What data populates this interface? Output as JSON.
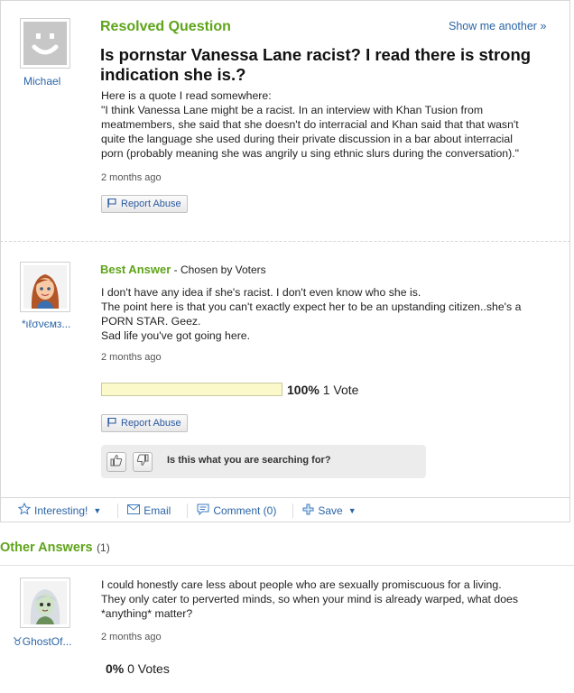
{
  "question": {
    "status_label": "Resolved Question",
    "show_another": "Show me another »",
    "asker": "Michael",
    "title_line1": "Is pornstar Vanessa Lane racist? I read there is strong",
    "title_line2": "indication she is.?",
    "body_lines": [
      "Here is a quote I read somewhere:",
      "\"I think Vanessa Lane might be a racist. In an interview with Khan Tusion from",
      "meatmembers, she said that she doesn't do interracial and Khan said that that wasn't",
      "quite the language she used during their private discussion in a bar about interracial",
      "porn (probably meaning she was angrily u sing ethnic slurs during the conversation).\""
    ],
    "time": "2 months ago",
    "report_label": "Report Abuse"
  },
  "best_answer": {
    "heading": "Best Answer",
    "chosen_by": " - Chosen by Voters",
    "user": "*ιℓσνємз...",
    "body_lines": [
      "I don't have any idea if she's racist. I don't even know who she is.",
      "The point here is that you can't exactly expect her to be an upstanding citizen..she's a",
      "PORN STAR. Geez.",
      "Sad life you've got going here."
    ],
    "time": "2 months ago",
    "vote_percent_label": "100%",
    "vote_percent": 100,
    "vote_count_label": "1 Vote",
    "report_label": "Report Abuse",
    "feedback_prompt": "Is this what you are searching for?"
  },
  "toolbar": {
    "interesting": "Interesting!",
    "email": "Email",
    "comment": "Comment (0)",
    "save": "Save"
  },
  "other_answers": {
    "heading": "Other Answers",
    "count": "(1)",
    "items": [
      {
        "user": "♉GhostOf...",
        "body_lines": [
          "I could honestly care less about people who are sexually promiscuous for a living.",
          "They only cater to perverted minds, so when your mind is already warped, what does",
          "*anything* matter?"
        ],
        "time": "2 months ago",
        "vote_percent_label": "0%",
        "vote_count_label": "0 Votes"
      }
    ]
  },
  "colors": {
    "accent_green": "#5fa41a",
    "link_blue": "#2b65a6",
    "vote_fill": "#fbf8c9"
  }
}
